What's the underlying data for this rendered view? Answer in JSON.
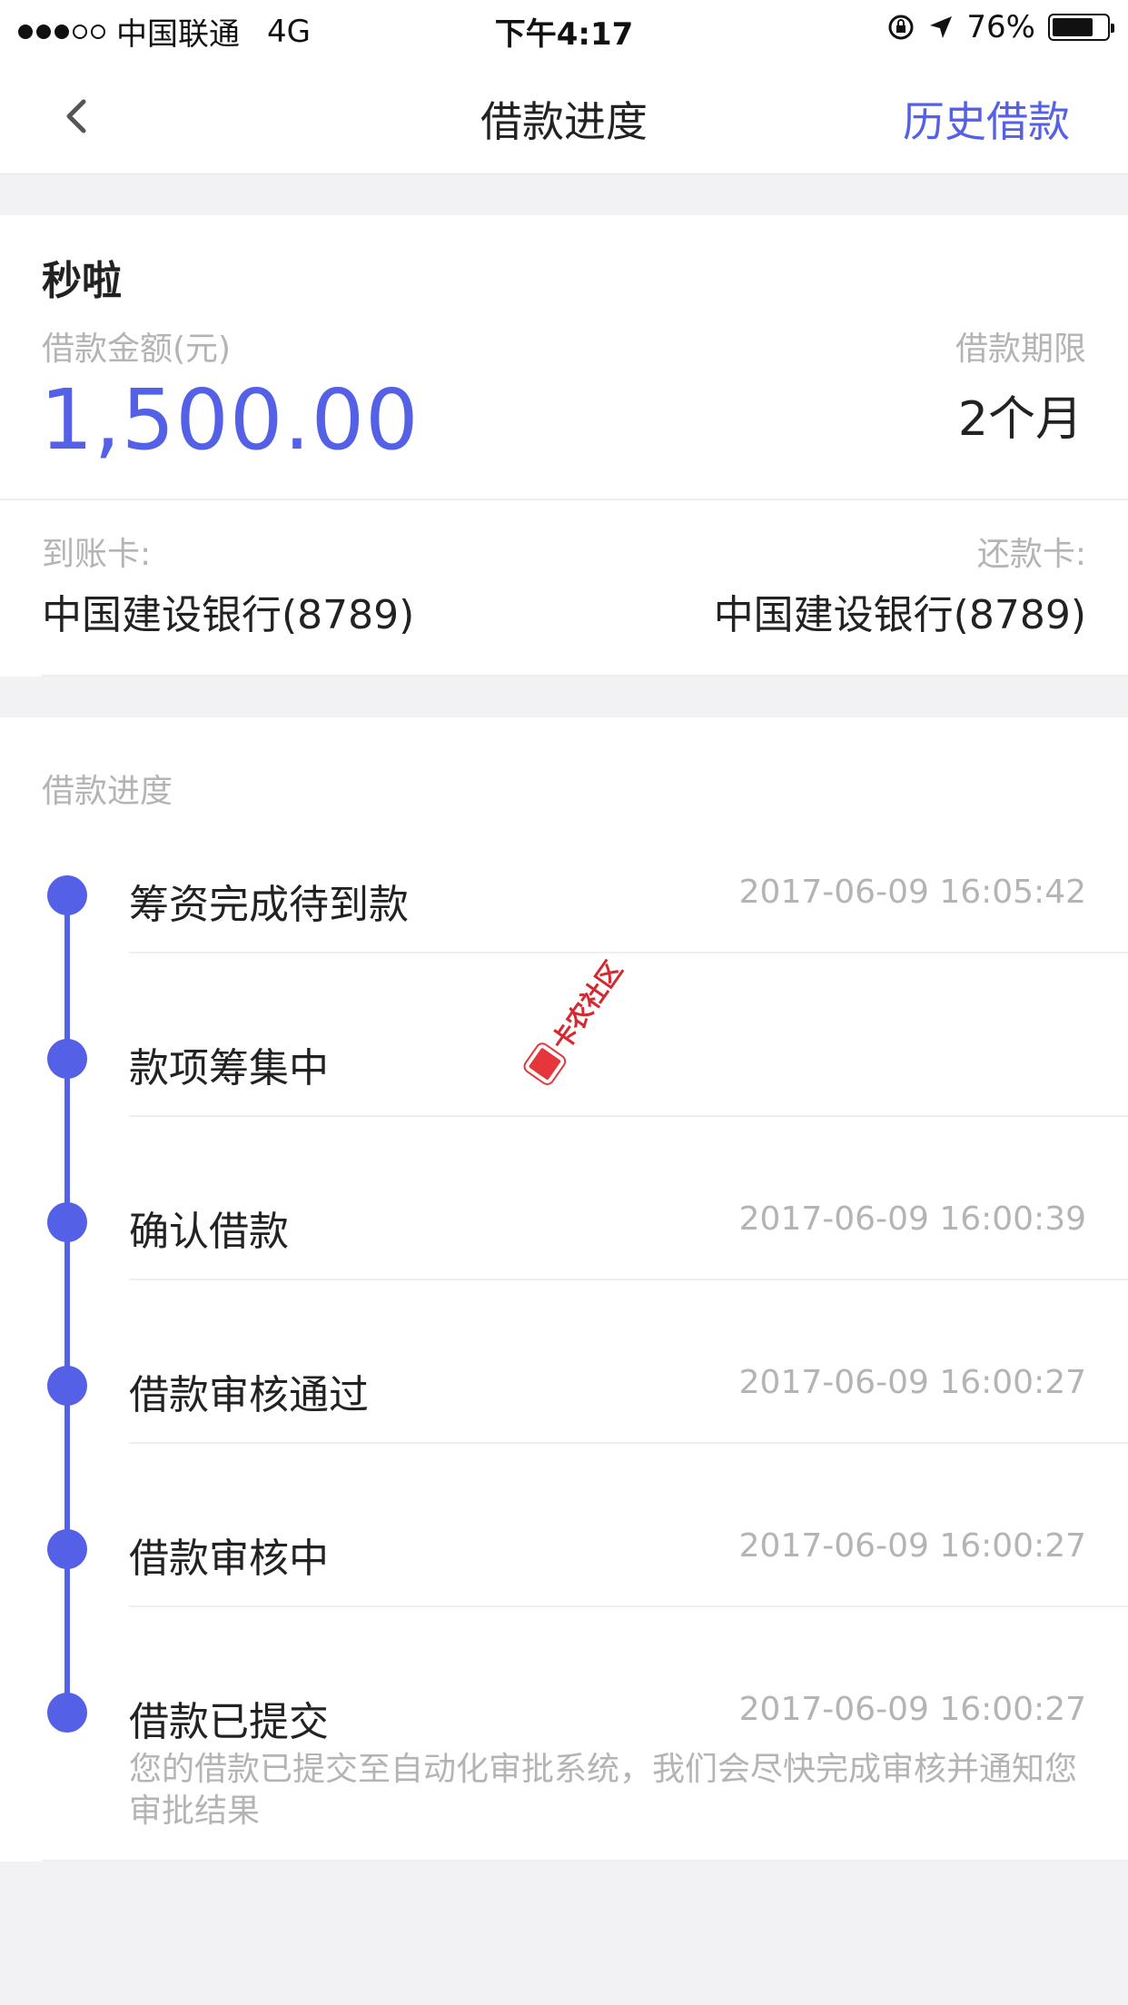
{
  "status_bar": {
    "carrier": "中国联通",
    "network": "4G",
    "time": "下午4:17",
    "battery_percent": "76%",
    "battery_level": 0.76
  },
  "nav": {
    "title": "借款进度",
    "history_link": "历史借款",
    "back_icon": "chevron-left-icon"
  },
  "summary": {
    "product_name": "秒啦",
    "amount_label": "借款金额(元)",
    "amount_value": "1,500.00",
    "term_label": "借款期限",
    "term_value": "2个月",
    "receive_card_label": "到账卡:",
    "receive_card_value": "中国建设银行(8789)",
    "repay_card_label": "还款卡:",
    "repay_card_value": "中国建设银行(8789)"
  },
  "progress": {
    "title": "借款进度",
    "steps": [
      {
        "label": "筹资完成待到款",
        "time": "2017-06-09 16:05:42"
      },
      {
        "label": "款项筹集中",
        "time": ""
      },
      {
        "label": "确认借款",
        "time": "2017-06-09 16:00:39"
      },
      {
        "label": "借款审核通过",
        "time": "2017-06-09 16:00:27"
      },
      {
        "label": "借款审核中",
        "time": "2017-06-09 16:00:27"
      },
      {
        "label": "借款已提交",
        "time": "2017-06-09 16:00:27",
        "description": "您的借款已提交至自动化审批系统，我们会尽快完成审核并通知您审批结果"
      }
    ]
  },
  "watermark": {
    "text": "卡农社区"
  },
  "colors": {
    "accent": "#5460e6",
    "muted": "#b4b4b4",
    "background": "#f2f2f4"
  }
}
